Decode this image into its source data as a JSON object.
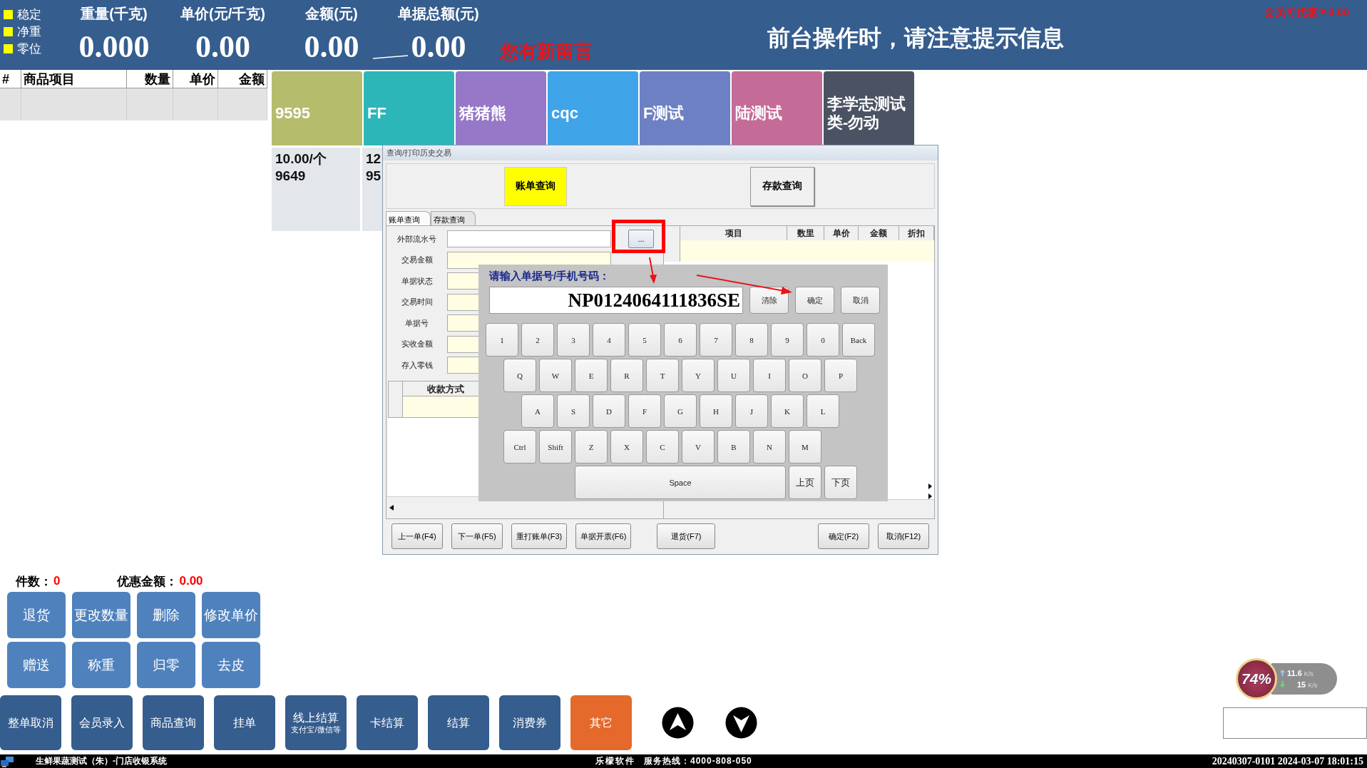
{
  "indicators": [
    {
      "label": "稳定"
    },
    {
      "label": "净重"
    },
    {
      "label": "零位"
    }
  ],
  "scale": [
    {
      "label": "重量(千克)",
      "value": "0.000"
    },
    {
      "label": "单价(元/千克)",
      "value": "0.00"
    },
    {
      "label": "金额(元)",
      "value": "0.00"
    },
    {
      "label": "单据总额(元)",
      "value": "0.00"
    }
  ],
  "message_alert": "您有新留言",
  "notice": "前台操作时，请注意提示信息",
  "member_discount": "会员可优惠￥0.00",
  "cart_table": {
    "columns": [
      "#",
      "商品项目",
      "数量",
      "单价",
      "金额"
    ]
  },
  "product_tiles": [
    {
      "label": "9595",
      "color": "#b5bc6c"
    },
    {
      "label": "FF",
      "color": "#2cb6b8"
    },
    {
      "label": "猪猪熊",
      "color": "#9677c8"
    },
    {
      "label": "cqc",
      "color": "#3fa4e8"
    },
    {
      "label": "F测试",
      "color": "#6d80c4"
    },
    {
      "label": "陆测试",
      "color": "#c56b97"
    },
    {
      "label": "李学志测试类-勿动",
      "color": "#4a5263"
    }
  ],
  "product_cards": [
    {
      "lines": [
        "10.00/个",
        "9649"
      ]
    },
    {
      "lines": [
        "12",
        "95"
      ]
    }
  ],
  "dialog": {
    "title": "查询/打印历史交易",
    "mode_buttons": [
      {
        "label": "账单查询",
        "selected": true
      },
      {
        "label": "存款查询",
        "selected": false
      }
    ],
    "tabs": [
      {
        "label": "账单查询",
        "selected": true
      },
      {
        "label": "存款查询",
        "selected": false
      }
    ],
    "fields": [
      {
        "label": "外部流水号",
        "kind": "input"
      },
      {
        "label": "交易金额",
        "kind": "readonly"
      },
      {
        "label": "单据状态",
        "kind": "readonly"
      },
      {
        "label": "交易时间",
        "kind": "readonly"
      },
      {
        "label": "单据号",
        "kind": "readonly"
      },
      {
        "label": "实收金额",
        "kind": "readonly"
      },
      {
        "label": "存入零钱",
        "kind": "readonly"
      }
    ],
    "browse_button": "...",
    "payment_table": {
      "columns": [
        "收款方式"
      ]
    },
    "items_table": {
      "columns": [
        "项目",
        "数里",
        "单价",
        "金额",
        "折扣"
      ]
    },
    "footer_buttons": [
      [
        "上一单(F4)",
        "下一单(F5)",
        "重打账单(F3)",
        "单据开票(F6)"
      ],
      [
        "退货(F7)"
      ],
      [
        "确定(F2)",
        "取消(F12)"
      ]
    ]
  },
  "keypad": {
    "prompt": "请输入单据号/手机号码：",
    "value": "NP0124064111836SE",
    "actions": [
      "清除",
      "确定",
      "取消"
    ],
    "key_rows": [
      [
        "1",
        "2",
        "3",
        "4",
        "5",
        "6",
        "7",
        "8",
        "9",
        "0",
        "Back"
      ],
      [
        "Q",
        "W",
        "E",
        "R",
        "T",
        "Y",
        "U",
        "I",
        "O",
        "P"
      ],
      [
        "A",
        "S",
        "D",
        "F",
        "G",
        "H",
        "J",
        "K",
        "L"
      ],
      [
        "Ctrl",
        "Shift",
        "Z",
        "X",
        "C",
        "V",
        "B",
        "N",
        "M"
      ]
    ],
    "space_row": {
      "space": "Space",
      "keys": [
        "上页",
        "下页"
      ]
    }
  },
  "summary": [
    {
      "label": "件数：",
      "value": "0"
    },
    {
      "label": "优惠金额：",
      "value": "0.00"
    }
  ],
  "function_buttons": [
    "退货",
    "更改数量",
    "删除",
    "修改单价",
    "赠送",
    "称重",
    "归零",
    "去皮"
  ],
  "action_buttons": [
    {
      "label": "整单取消",
      "color": "#355d8e"
    },
    {
      "label": "会员录入",
      "color": "#355d8e"
    },
    {
      "label": "商品查询",
      "color": "#355d8e"
    },
    {
      "label": "挂单",
      "color": "#355d8e"
    },
    {
      "label": "线上结算",
      "sublabel": "支付宝/微信等",
      "color": "#355d8e"
    },
    {
      "label": "卡结算",
      "color": "#355d8e"
    },
    {
      "label": "结算",
      "color": "#355d8e"
    },
    {
      "label": "消费券",
      "color": "#355d8e"
    },
    {
      "label": "其它",
      "color": "#e4692b"
    }
  ],
  "network": {
    "percent": "74%",
    "upload": {
      "value": "11.6",
      "unit": "K/s"
    },
    "download": {
      "value": "15",
      "unit": "K/s"
    }
  },
  "status_bar": {
    "title": "生鲜果蔬测试（朱）-门店收银系统",
    "company": "乐檬软件",
    "hotline": "服务热线：4000-808-050",
    "right": "20240307-0101 2024-03-07 18:01:15"
  }
}
